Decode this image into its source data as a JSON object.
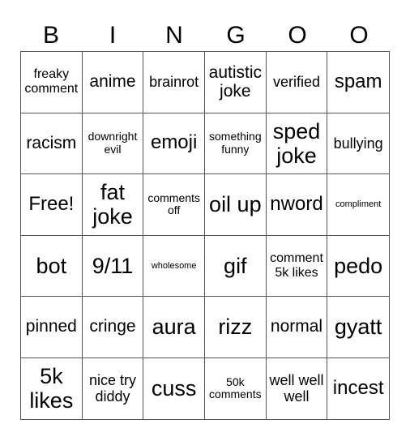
{
  "header": [
    "B",
    "I",
    "N",
    "G",
    "O",
    "O"
  ],
  "cells": [
    "freaky comment",
    "anime",
    "brainrot",
    "autistic joke",
    "verified",
    "spam",
    "racism",
    "downright evil",
    "emoji",
    "something funny",
    "sped joke",
    "bullying",
    "Free!",
    "fat joke",
    "comments off",
    "oil up",
    "nword",
    "compliment",
    "bot",
    "9/11",
    "wholesome",
    "gif",
    "comment 5k likes",
    "pedo",
    "pinned",
    "cringe",
    "aura",
    "rizz",
    "normal",
    "gyatt",
    "5k likes",
    "nice try diddy",
    "cuss",
    "50k comments",
    "well well well",
    "incest"
  ]
}
